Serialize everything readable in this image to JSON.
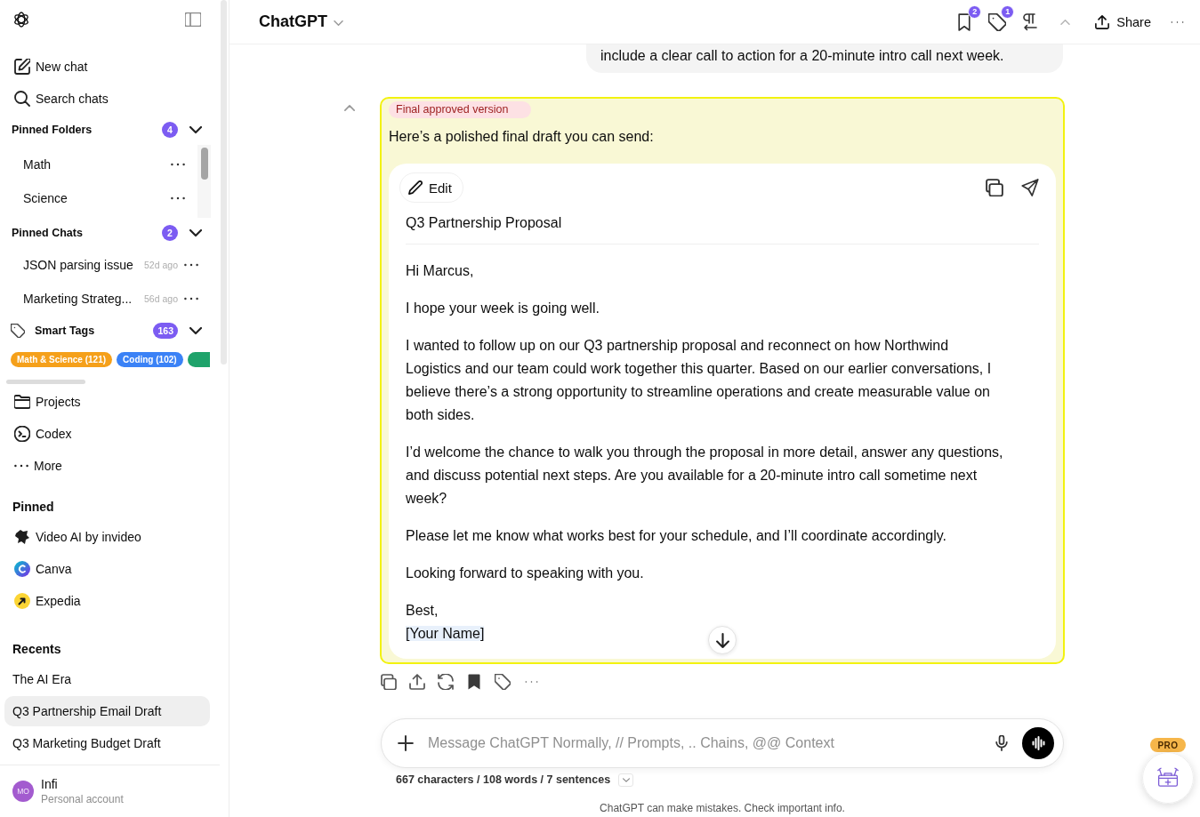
{
  "sidebar": {
    "nav": [
      {
        "label": "New chat"
      },
      {
        "label": "Search chats"
      }
    ],
    "pinned_folders": {
      "title": "Pinned Folders",
      "count": "4",
      "expanded": true,
      "items": [
        {
          "label": "Math"
        },
        {
          "label": "Science"
        }
      ]
    },
    "pinned_chats": {
      "title": "Pinned Chats",
      "count": "2",
      "expanded": true,
      "items": [
        {
          "label": "JSON parsing issue",
          "age": "52d ago"
        },
        {
          "label": "Marketing Strateg...",
          "age": "56d ago"
        }
      ]
    },
    "smart_tags": {
      "title": "Smart Tags",
      "count": "163",
      "expanded": true,
      "tags": [
        {
          "label": "Math & Science (121)",
          "color": "#f5a01a"
        },
        {
          "label": "Coding (102)",
          "color": "#3b82f6"
        },
        {
          "color": "#1fa36b"
        }
      ]
    },
    "tools": [
      {
        "label": "Projects"
      },
      {
        "label": "Codex"
      },
      {
        "label": "More"
      }
    ],
    "pinned_apps": {
      "title": "Pinned",
      "items": [
        {
          "label": "Video AI by invideo"
        },
        {
          "label": "Canva"
        },
        {
          "label": "Expedia"
        }
      ]
    },
    "recents": {
      "title": "Recents",
      "items": [
        {
          "label": "The AI Era",
          "selected": false
        },
        {
          "label": "Q3 Partnership Email Draft",
          "selected": true
        },
        {
          "label": "Q3 Marketing Budget Draft",
          "selected": false
        }
      ]
    },
    "account": {
      "initials": "MO",
      "name": "Infi",
      "plan": "Personal account"
    }
  },
  "header": {
    "title": "ChatGPT",
    "badges": {
      "bookmarks": "2",
      "tags": "1"
    },
    "share_label": "Share"
  },
  "conversation": {
    "user_message": "include a clear call to action for a 20-minute intro call next week.",
    "assistant_message": {
      "label": "Final approved version",
      "intro": "Here’s a polished final draft you can send:",
      "draft": {
        "edit_label": "Edit",
        "subject": "Q3 Partnership Proposal",
        "paragraphs": [
          "Hi Marcus,",
          "I hope your week is going well.",
          "I wanted to follow up on our Q3 partnership proposal and reconnect on how Northwind Logistics and our team could work together this quarter. Based on our earlier conversations, I believe there’s a strong opportunity to streamline operations and create measurable value on both sides.",
          "I’d welcome the chance to walk you through the proposal in more detail, answer any questions, and discuss potential next steps. Are you available for a 20-minute intro call sometime next week?",
          "Please let me know what works best for your schedule, and I’ll coordinate accordingly.",
          "Looking forward to speaking with you."
        ],
        "sign_off": "Best,",
        "signature": {
          "text": "[Your Name]",
          "highlighted": true
        }
      }
    }
  },
  "composer": {
    "placeholder": "Message ChatGPT Normally, // Prompts, .. Chains, @@ Context",
    "stats": "667 characters / 108 words / 7 sentences"
  },
  "footer_note": "ChatGPT can make mistakes. Check important info.",
  "pro_badge": "PRO"
}
